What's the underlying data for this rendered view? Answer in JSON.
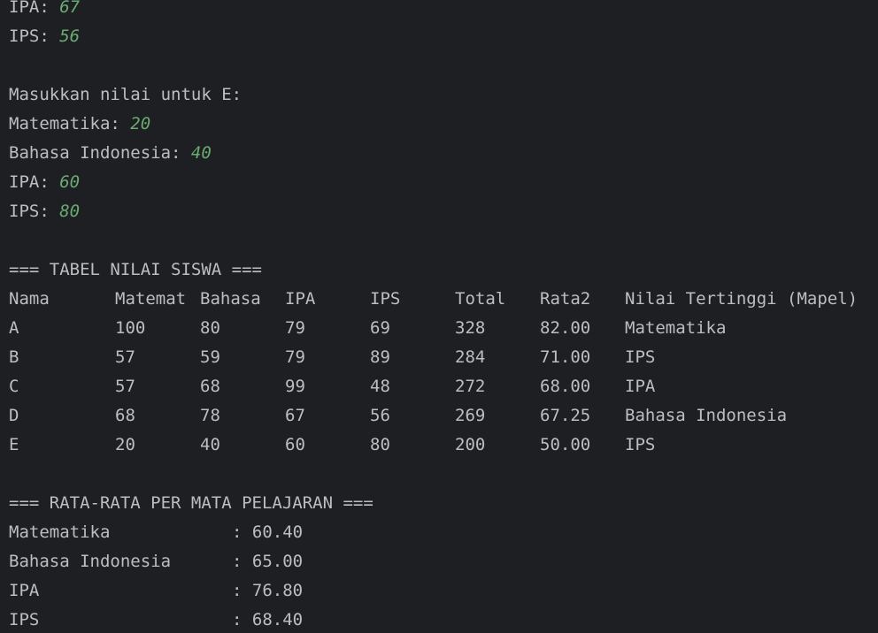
{
  "input_tail": {
    "d_ipa": {
      "label": "IPA: ",
      "value": "67"
    },
    "d_ips": {
      "label": "IPS: ",
      "value": "56"
    }
  },
  "prompt_e": {
    "header": "Masukkan nilai untuk E:",
    "matematika": {
      "label": "Matematika: ",
      "value": "20"
    },
    "bahasa": {
      "label": "Bahasa Indonesia: ",
      "value": "40"
    },
    "ipa": {
      "label": "IPA: ",
      "value": "60"
    },
    "ips": {
      "label": "IPS: ",
      "value": "80"
    }
  },
  "table": {
    "title": "=== TABEL NILAI SISWA ===",
    "headers": [
      "Nama",
      "Matemat",
      "Bahasa",
      "IPA",
      "IPS",
      "Total",
      "Rata2",
      "Nilai Tertinggi (Mapel)"
    ],
    "rows": [
      [
        "A",
        "100",
        "80",
        "79",
        "69",
        "328",
        "82.00",
        "Matematika"
      ],
      [
        "B",
        "57",
        "59",
        "79",
        "89",
        "284",
        "71.00",
        "IPS"
      ],
      [
        "C",
        "57",
        "68",
        "99",
        "48",
        "272",
        "68.00",
        "IPA"
      ],
      [
        "D",
        "68",
        "78",
        "67",
        "56",
        "269",
        "67.25",
        "Bahasa Indonesia"
      ],
      [
        "E",
        "20",
        "40",
        "60",
        "80",
        "200",
        "50.00",
        "IPS"
      ]
    ]
  },
  "averages": {
    "title": "=== RATA-RATA PER MATA PELAJARAN ===",
    "items": [
      {
        "label": "Matematika",
        "value": ": 60.40"
      },
      {
        "label": "Bahasa Indonesia",
        "value": ": 65.00"
      },
      {
        "label": "IPA",
        "value": ": 76.80"
      },
      {
        "label": "IPS",
        "value": ": 68.40"
      }
    ]
  },
  "colors": {
    "background": "#1e1f22",
    "text": "#bcbec4",
    "input_value": "#6aab73"
  }
}
